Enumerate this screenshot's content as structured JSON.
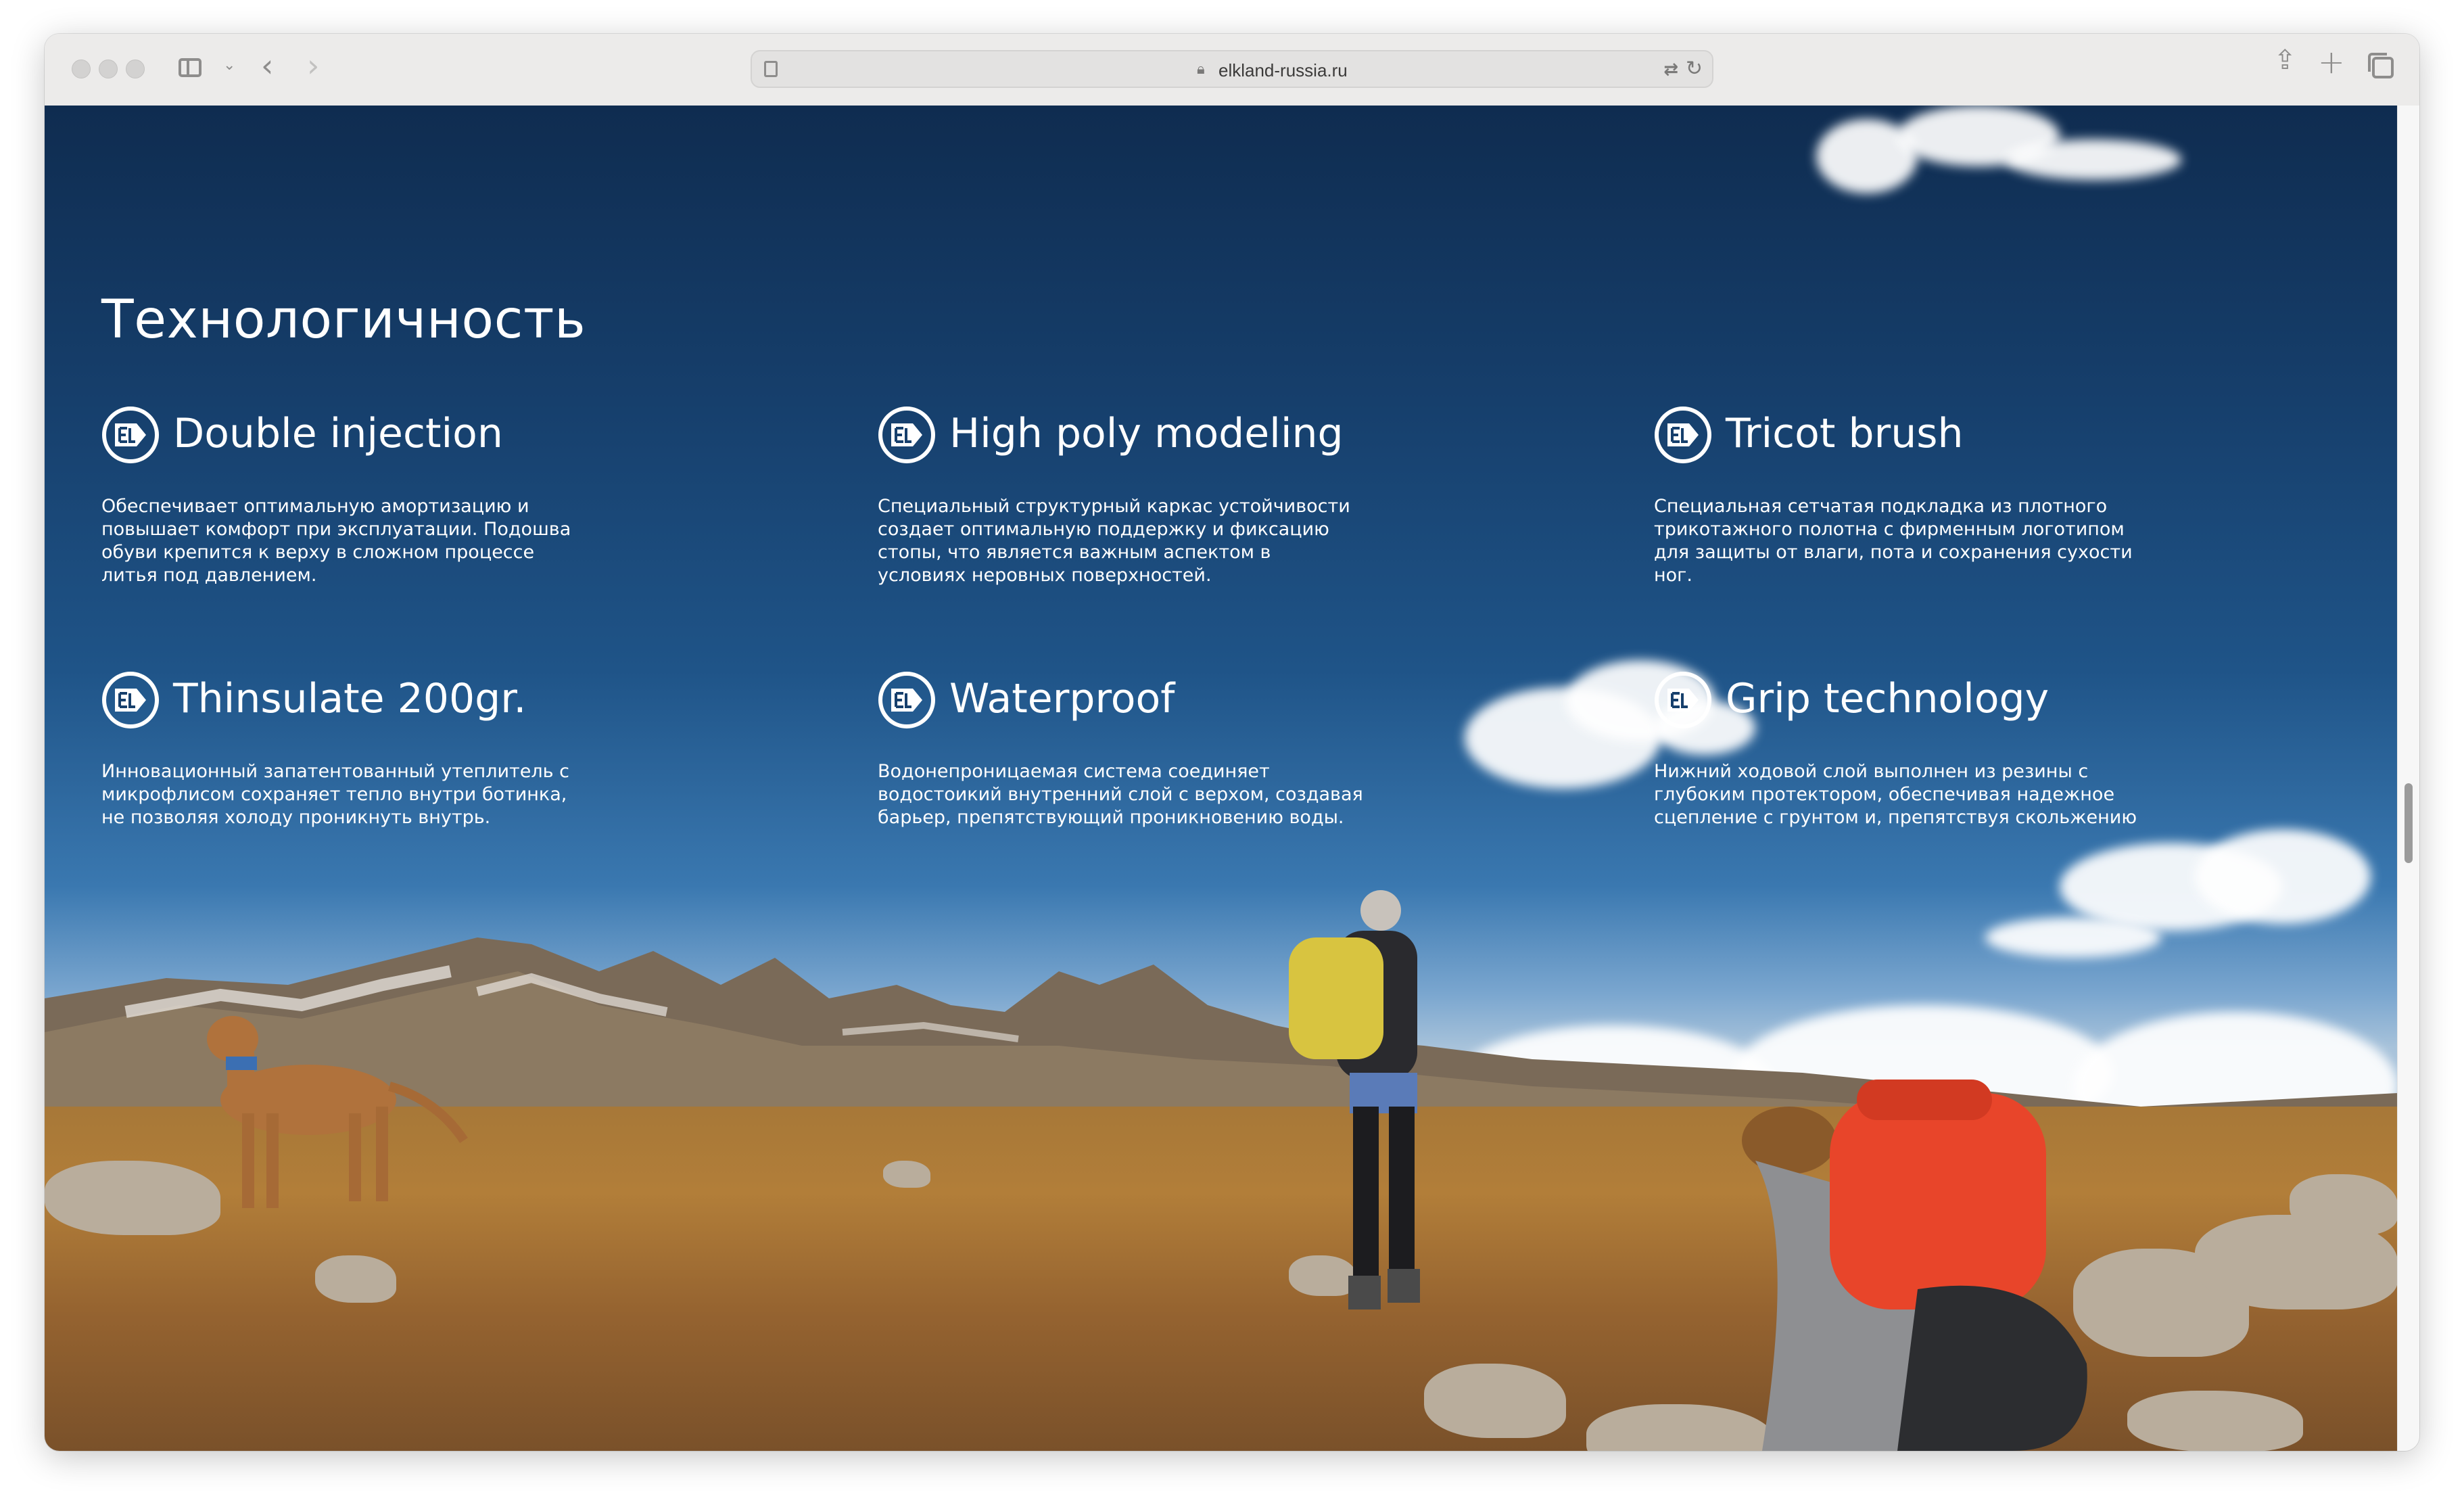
{
  "browser": {
    "url": "elkland-russia.ru"
  },
  "page": {
    "section_title": "Технологичность",
    "features": [
      {
        "title": "Double injection",
        "description": "Обеспечивает оптимальную амортизацию и повышает комфорт при эксплуатации. Подошва обуви крепится к верху в сложном процессе литья под давлением."
      },
      {
        "title": "High poly modeling",
        "description": "Специальный структурный каркас устойчивости создает оптимальную поддержку и фиксацию стопы, что является важным аспектом в условиях неровных поверхностей."
      },
      {
        "title": "Tricot brush",
        "description": "Специальная сетчатая подкладка из плотного трикотажного полотна с фирменным логотипом для защиты от влаги, пота и сохранения сухости ног."
      },
      {
        "title": "Thinsulate 200gr.",
        "description": "Инновационный запатентованный утеплитель с микрофлисом сохраняет тепло внутри ботинка, не позволяя холоду проникнуть внутрь."
      },
      {
        "title": "Waterproof",
        "description": "Водонепроницаемая система соединяет водостоикий внутренний слой с верхом, создавая барьер, препятствующий проникновению воды."
      },
      {
        "title": "Grip technology",
        "description": "Нижний ходовой слой выполнен из резины с глубоким протектором, обеспечивая надежное сцепление с грунтом и, препятствуя скольжению"
      }
    ]
  },
  "icons": {
    "feature_icon": "el-logo-icon",
    "toolbar": [
      "sidebar-icon",
      "chevron-down-icon",
      "back-arrow-icon",
      "forward-arrow-icon",
      "reader-icon",
      "lock-icon",
      "translate-icon",
      "reload-icon",
      "share-icon",
      "new-tab-icon",
      "tab-overview-icon"
    ]
  },
  "colors": {
    "sky_top": "#0f2c50",
    "sky_mid": "#1f5488",
    "text": "#ffffff",
    "grass": "#a77838",
    "backpack_orange": "#e8452a",
    "backpack_yellow": "#d8c440"
  }
}
